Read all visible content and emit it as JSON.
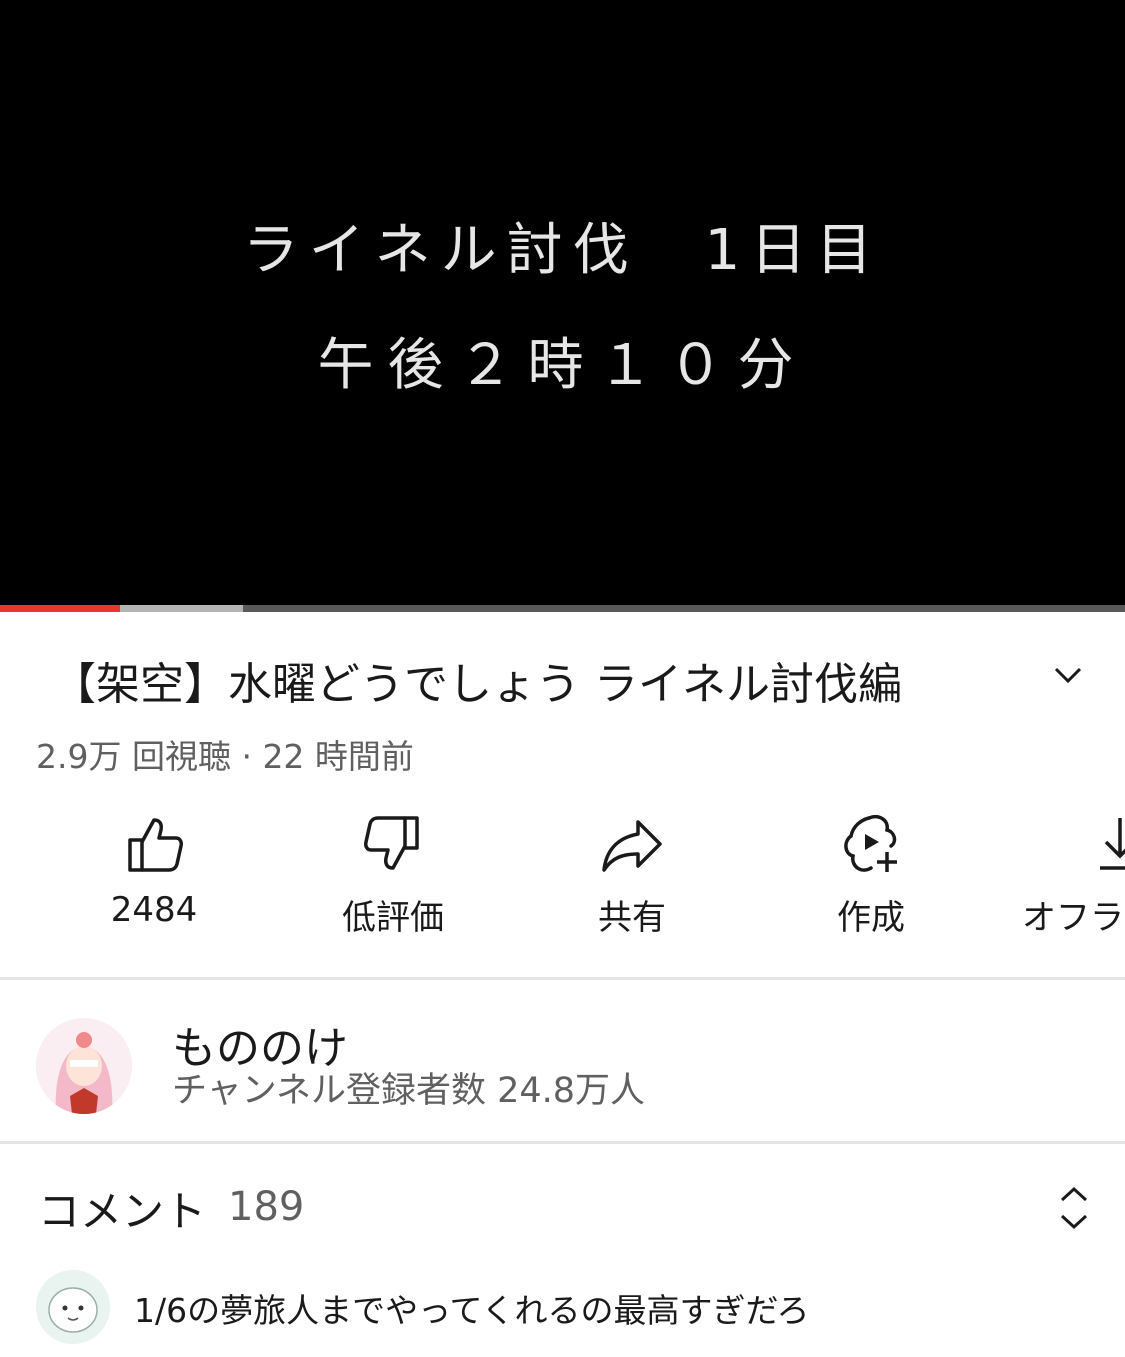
{
  "video": {
    "overlay_line1": "ライネル討伐　1日目",
    "overlay_line2": "午後２時１０分",
    "progress_played": 0.107,
    "progress_buffered": 0.216,
    "title": "【架空】水曜どうでしょう ライネル討伐編",
    "meta": "2.9万 回視聴 · 22 時間前"
  },
  "actions": {
    "like_label": "2484",
    "dislike_label": "低評価",
    "share_label": "共有",
    "create_label": "作成",
    "offline_label": "オフラ"
  },
  "channel": {
    "name": "もののけ",
    "subscribers": "チャンネル登録者数 24.8万人"
  },
  "comments": {
    "heading": "コメント",
    "count": "189",
    "first_comment": "1/6の夢旅人までやってくれるの最高すぎだろ"
  },
  "colors": {
    "progress_red": "#e53a2b",
    "secondary_text": "#606060"
  },
  "icons": [
    "chevron-down-icon",
    "thumbs-up-icon",
    "thumbs-down-icon",
    "share-icon",
    "create-icon",
    "download-icon",
    "sort-icon"
  ]
}
